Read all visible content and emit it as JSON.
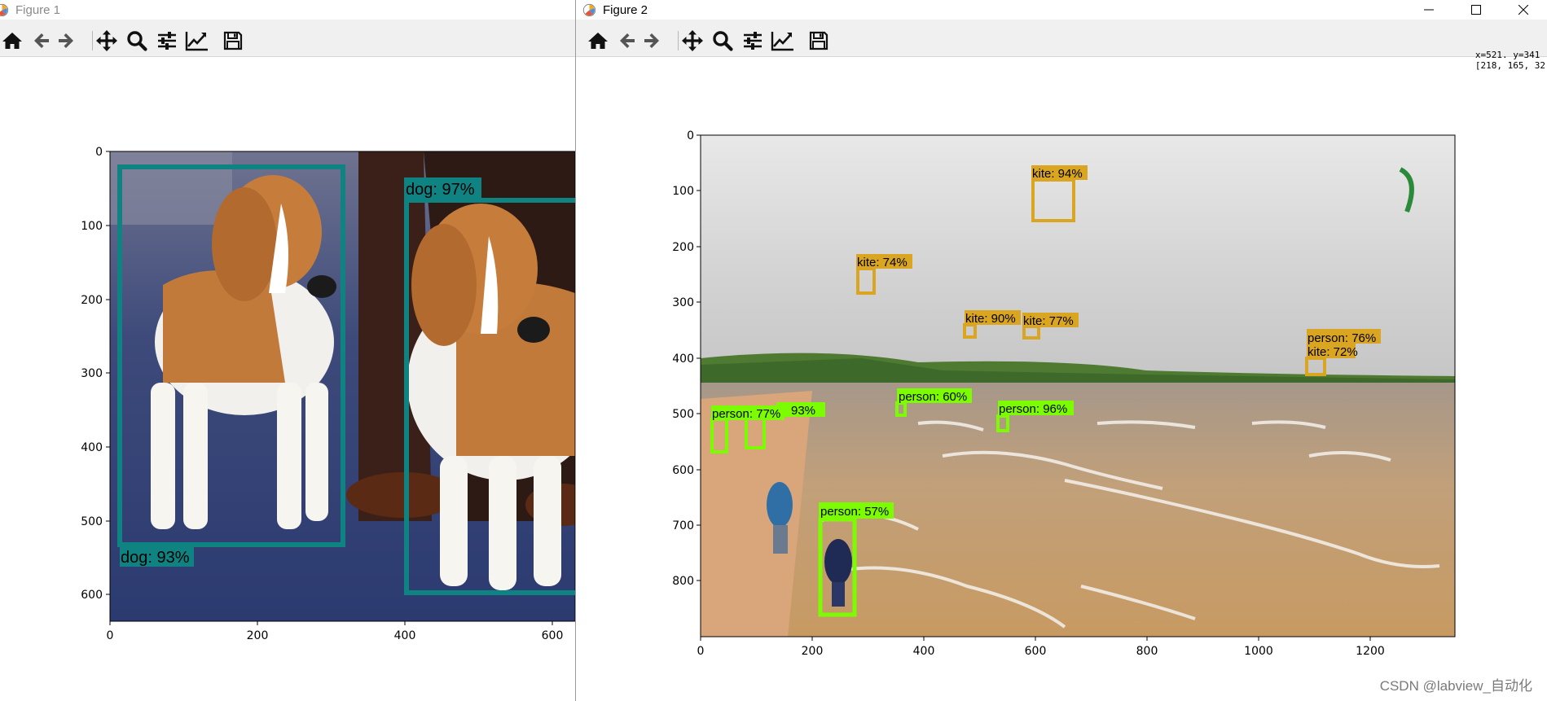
{
  "figure1": {
    "title": "Figure 1",
    "x_ticks": [
      "0",
      "200",
      "400",
      "600"
    ],
    "y_ticks": [
      "0",
      "100",
      "200",
      "300",
      "400",
      "500",
      "600"
    ],
    "detections": [
      {
        "label": "dog: 93%",
        "color": "#0f8282"
      },
      {
        "label": "dog: 97%",
        "color": "#0f8282"
      }
    ]
  },
  "figure2": {
    "title": "Figure 2",
    "coords": "x=521. y=341\n[218, 165, 32",
    "x_ticks": [
      "0",
      "200",
      "400",
      "600",
      "800",
      "1000",
      "1200"
    ],
    "y_ticks": [
      "0",
      "100",
      "200",
      "300",
      "400",
      "500",
      "600",
      "700",
      "800"
    ],
    "detections": [
      {
        "label": "kite: 94%",
        "color": "#daa520"
      },
      {
        "label": "kite: 74%",
        "color": "#daa520"
      },
      {
        "label": "kite: 90%",
        "color": "#daa520"
      },
      {
        "label": "kite: 77%",
        "color": "#daa520"
      },
      {
        "label": "person: 76%",
        "color": "#daa520"
      },
      {
        "label": "kite: 72%",
        "color": "#daa520"
      },
      {
        "label": "person: 77%",
        "color": "#7cfc00"
      },
      {
        "label": "93%",
        "color": "#7cfc00"
      },
      {
        "label": "person: 60%",
        "color": "#7cfc00"
      },
      {
        "label": "person: 96%",
        "color": "#7cfc00"
      },
      {
        "label": "person: 57%",
        "color": "#7cfc00"
      }
    ]
  },
  "toolbar_icons": [
    "home-icon",
    "back-arrow-icon",
    "forward-arrow-icon",
    "pan-icon",
    "zoom-icon",
    "configure-subplots-icon",
    "edit-axis-icon",
    "save-icon"
  ],
  "watermark": "CSDN @labview_自动化"
}
